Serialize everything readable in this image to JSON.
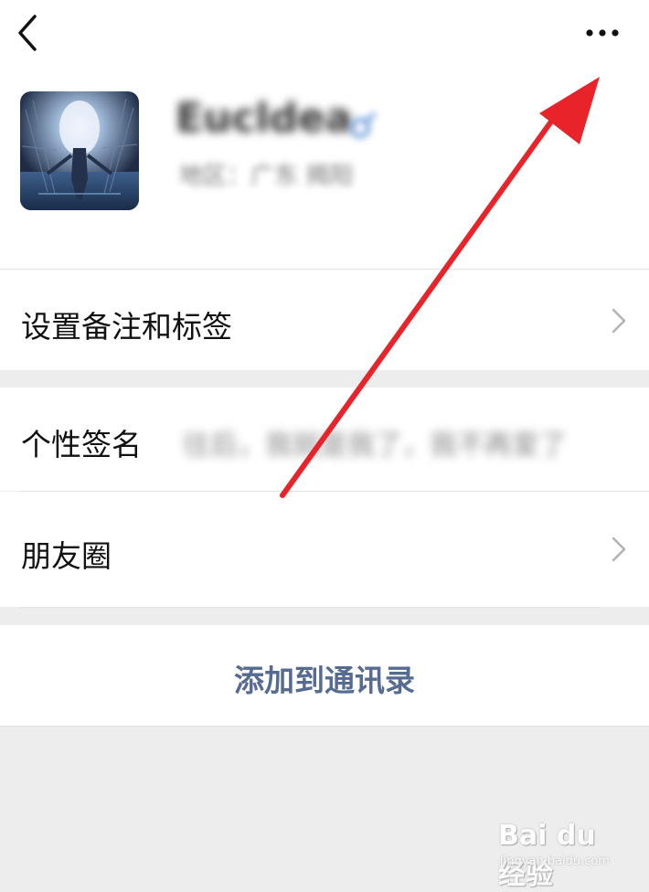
{
  "header": {
    "back_icon": "chevron-left-icon",
    "more_icon": "more-dots-icon"
  },
  "profile": {
    "nickname": "Eucldea",
    "gender_icon": "gender-male-icon",
    "region": "地区：广东 揭阳"
  },
  "menu": {
    "remark_label": "设置备注和标签",
    "signature_label": "个性签名",
    "signature_value": "往后，我就是我了，我不再爱了",
    "moments_label": "朋友圈",
    "chevron_icon": "chevron-right-icon"
  },
  "actions": {
    "add_label": "添加到通讯录"
  },
  "annotation": {
    "arrow_color": "#e8232a"
  },
  "watermark": {
    "brand": "Bai du 经验",
    "site": "jingyan.baidu.com"
  },
  "colors": {
    "accent_link": "#566b92",
    "background": "#ededed"
  }
}
